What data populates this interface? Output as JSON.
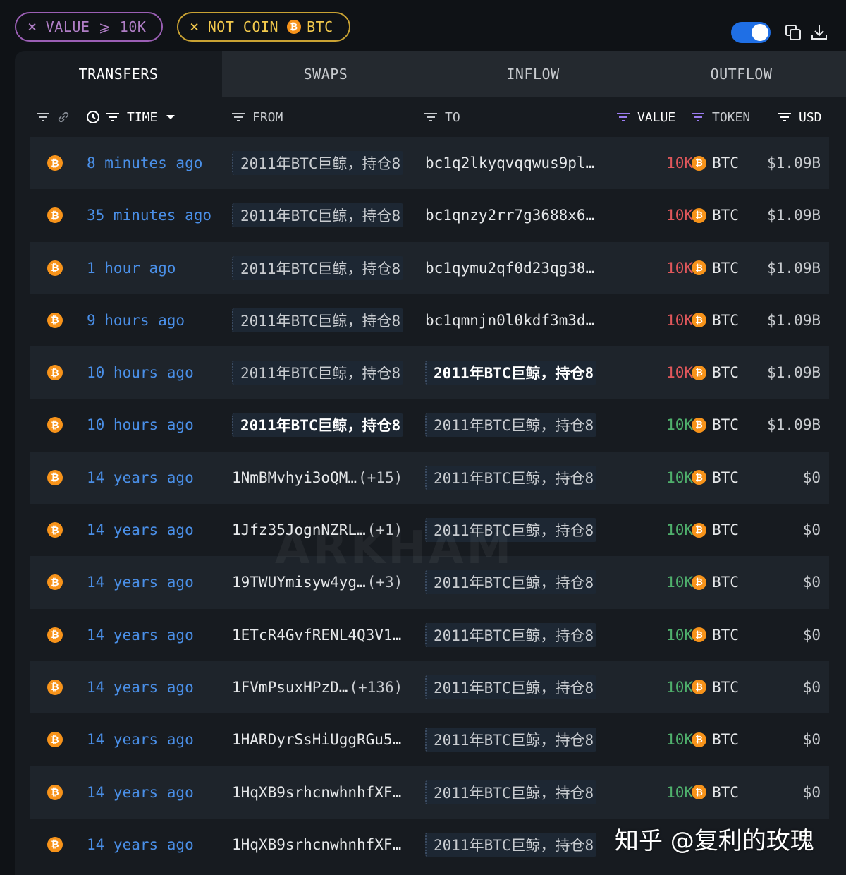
{
  "filters": {
    "value_chip": "VALUE ⩾ 10K",
    "coin_chip_prefix": "NOT COIN",
    "coin_chip_token": "BTC",
    "coin_icon_glyph": "₿",
    "remove_glyph": "×"
  },
  "toolbar": {
    "toggle_on": true,
    "icons": [
      "copy-icon",
      "download-icon"
    ]
  },
  "tabs": [
    "TRANSFERS",
    "SWAPS",
    "INFLOW",
    "OUTFLOW"
  ],
  "active_tab": "TRANSFERS",
  "columns": {
    "time": "TIME",
    "from": "FROM",
    "to": "TO",
    "value": "VALUE",
    "token": "TOKEN",
    "usd": "USD"
  },
  "colors": {
    "value_outflow": "#e0575b",
    "value_inflow": "#4fb06c",
    "time_link": "#4a8fe7",
    "btc_orange": "#f7931a",
    "accent_blue": "#1f6fe5"
  },
  "rows": [
    {
      "time": "8 minutes ago",
      "from": "2011年BTC巨鲸，持仓8",
      "from_type": "entity",
      "from_hl": false,
      "to": "bc1q2lkyqvqqwus9pl…",
      "to_type": "addr",
      "to_hl": false,
      "to_extra": "",
      "from_extra": "",
      "value": "10K",
      "dir": "out",
      "token": "BTC",
      "usd": "$1.09B"
    },
    {
      "time": "35 minutes ago",
      "from": "2011年BTC巨鲸，持仓8",
      "from_type": "entity",
      "from_hl": false,
      "to": "bc1qnzy2rr7g3688x6…",
      "to_type": "addr",
      "to_hl": false,
      "to_extra": "",
      "from_extra": "",
      "value": "10K",
      "dir": "out",
      "token": "BTC",
      "usd": "$1.09B"
    },
    {
      "time": "1 hour ago",
      "from": "2011年BTC巨鲸，持仓8",
      "from_type": "entity",
      "from_hl": false,
      "to": "bc1qymu2qf0d23qg38…",
      "to_type": "addr",
      "to_hl": false,
      "to_extra": "",
      "from_extra": "",
      "value": "10K",
      "dir": "out",
      "token": "BTC",
      "usd": "$1.09B"
    },
    {
      "time": "9 hours ago",
      "from": "2011年BTC巨鲸，持仓8",
      "from_type": "entity",
      "from_hl": false,
      "to": "bc1qmnjn0l0kdf3m3d…",
      "to_type": "addr",
      "to_hl": false,
      "to_extra": "",
      "from_extra": "",
      "value": "10K",
      "dir": "out",
      "token": "BTC",
      "usd": "$1.09B"
    },
    {
      "time": "10 hours ago",
      "from": "2011年BTC巨鲸，持仓8",
      "from_type": "entity",
      "from_hl": false,
      "to": "2011年BTC巨鲸，持仓8",
      "to_type": "entity",
      "to_hl": true,
      "to_extra": "",
      "from_extra": "",
      "value": "10K",
      "dir": "out",
      "token": "BTC",
      "usd": "$1.09B"
    },
    {
      "time": "10 hours ago",
      "from": "2011年BTC巨鲸，持仓8",
      "from_type": "entity",
      "from_hl": true,
      "to": "2011年BTC巨鲸，持仓8",
      "to_type": "entity",
      "to_hl": false,
      "to_extra": "",
      "from_extra": "",
      "value": "10K",
      "dir": "in",
      "token": "BTC",
      "usd": "$1.09B"
    },
    {
      "time": "14 years ago",
      "from": "1NmBMvhyi3oQM…",
      "from_type": "addr",
      "from_hl": false,
      "from_extra": "(+15)",
      "to": "2011年BTC巨鲸，持仓8",
      "to_type": "entity",
      "to_hl": false,
      "to_extra": "",
      "value": "10K",
      "dir": "in",
      "token": "BTC",
      "usd": "$0"
    },
    {
      "time": "14 years ago",
      "from": "1Jfz35JognNZRL…",
      "from_type": "addr",
      "from_hl": false,
      "from_extra": "(+1)",
      "to": "2011年BTC巨鲸，持仓8",
      "to_type": "entity",
      "to_hl": false,
      "to_extra": "",
      "value": "10K",
      "dir": "in",
      "token": "BTC",
      "usd": "$0"
    },
    {
      "time": "14 years ago",
      "from": "19TWUYmisyw4yg…",
      "from_type": "addr",
      "from_hl": false,
      "from_extra": "(+3)",
      "to": "2011年BTC巨鲸，持仓8",
      "to_type": "entity",
      "to_hl": false,
      "to_extra": "",
      "value": "10K",
      "dir": "in",
      "token": "BTC",
      "usd": "$0"
    },
    {
      "time": "14 years ago",
      "from": "1ETcR4GvfRENL4Q3V1…",
      "from_type": "addr",
      "from_hl": false,
      "from_extra": "",
      "to": "2011年BTC巨鲸，持仓8",
      "to_type": "entity",
      "to_hl": false,
      "to_extra": "",
      "value": "10K",
      "dir": "in",
      "token": "BTC",
      "usd": "$0"
    },
    {
      "time": "14 years ago",
      "from": "1FVmPsuxHPzD…",
      "from_type": "addr",
      "from_hl": false,
      "from_extra": "(+136)",
      "to": "2011年BTC巨鲸，持仓8",
      "to_type": "entity",
      "to_hl": false,
      "to_extra": "",
      "value": "10K",
      "dir": "in",
      "token": "BTC",
      "usd": "$0"
    },
    {
      "time": "14 years ago",
      "from": "1HARDyrSsHiUggRGu5…",
      "from_type": "addr",
      "from_hl": false,
      "from_extra": "",
      "to": "2011年BTC巨鲸，持仓8",
      "to_type": "entity",
      "to_hl": false,
      "to_extra": "",
      "value": "10K",
      "dir": "in",
      "token": "BTC",
      "usd": "$0"
    },
    {
      "time": "14 years ago",
      "from": "1HqXB9srhcnwhnhfXF…",
      "from_type": "addr",
      "from_hl": false,
      "from_extra": "",
      "to": "2011年BTC巨鲸，持仓8",
      "to_type": "entity",
      "to_hl": false,
      "to_extra": "",
      "value": "10K",
      "dir": "in",
      "token": "BTC",
      "usd": "$0"
    },
    {
      "time": "14 years ago",
      "from": "1HqXB9srhcnwhnhfXF…",
      "from_type": "addr",
      "from_hl": false,
      "from_extra": "",
      "to": "2011年BTC巨鲸，持仓8",
      "to_type": "entity",
      "to_hl": false,
      "to_extra": "",
      "value": "",
      "dir": "in",
      "token": "",
      "usd": ""
    }
  ],
  "watermark": "ARKHAM",
  "overlay_caption": "知乎 @复利的玫瑰"
}
